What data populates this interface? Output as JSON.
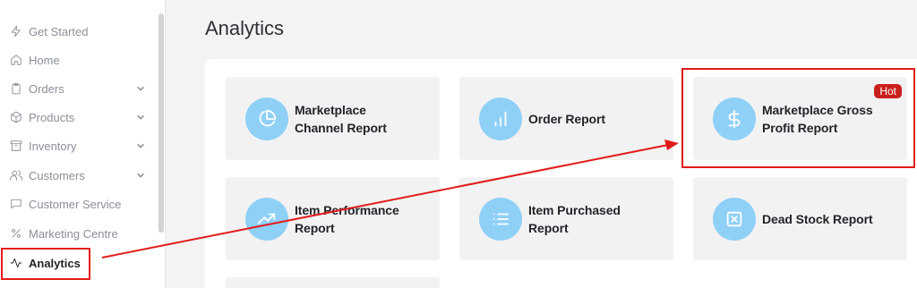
{
  "sidebar": {
    "items": [
      {
        "label": "Get Started",
        "icon": "bolt-icon",
        "has_chevron": false
      },
      {
        "label": "Home",
        "icon": "home-icon",
        "has_chevron": false
      },
      {
        "label": "Orders",
        "icon": "clipboard-icon",
        "has_chevron": true
      },
      {
        "label": "Products",
        "icon": "box-icon",
        "has_chevron": true
      },
      {
        "label": "Inventory",
        "icon": "archive-icon",
        "has_chevron": true
      },
      {
        "label": "Customers",
        "icon": "users-icon",
        "has_chevron": true
      },
      {
        "label": "Customer Service",
        "icon": "chat-icon",
        "has_chevron": false
      },
      {
        "label": "Marketing Centre",
        "icon": "percent-icon",
        "has_chevron": false
      },
      {
        "label": "Analytics",
        "icon": "activity-icon",
        "has_chevron": false,
        "active": true
      }
    ]
  },
  "main": {
    "title": "Analytics",
    "cards": [
      {
        "title_line1": "Marketplace",
        "title_line2": "Channel Report",
        "icon": "pie-chart-icon"
      },
      {
        "title_line1": "Order Report",
        "title_line2": "",
        "icon": "bar-chart-icon"
      },
      {
        "title_line1": "Marketplace Gross",
        "title_line2": "Profit Report",
        "icon": "dollar-icon",
        "badge": "Hot"
      },
      {
        "title_line1": "Item Performance",
        "title_line2": "Report",
        "icon": "trending-up-icon"
      },
      {
        "title_line1": "Item Purchased",
        "title_line2": "Report",
        "icon": "list-icon"
      },
      {
        "title_line1": "Dead Stock Report",
        "title_line2": "",
        "icon": "x-square-icon"
      }
    ]
  },
  "colors": {
    "accent_circle": "#8fd0f7",
    "annotation_red": "#e21b1b",
    "hot_badge": "#c8201c"
  }
}
